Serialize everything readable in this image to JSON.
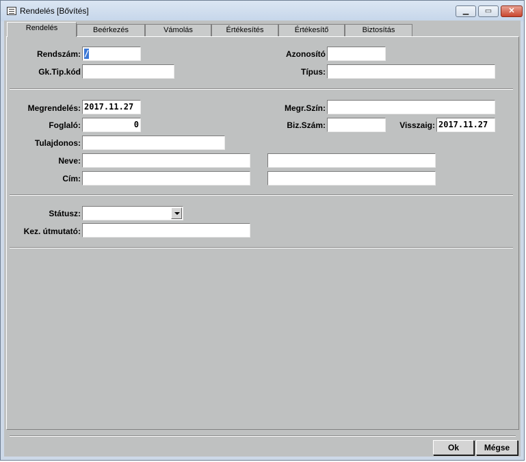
{
  "window": {
    "title": "Rendelés [Bővítés]"
  },
  "tabs": [
    {
      "label": "Rendelés"
    },
    {
      "label": "Beérkezés"
    },
    {
      "label": "Vámolás"
    },
    {
      "label": "Értékesítés"
    },
    {
      "label": "Értékesítő"
    },
    {
      "label": "Biztosítás"
    }
  ],
  "form": {
    "rendszam": {
      "label": "Rendszám:",
      "value": "/"
    },
    "azonosito": {
      "label": "Azonosító",
      "value": ""
    },
    "gktipkod": {
      "label": "Gk.Tip.kód",
      "value": ""
    },
    "tipus": {
      "label": "Típus:",
      "value": ""
    },
    "megrendeles": {
      "label": "Megrendelés:",
      "value": "2017.11.27"
    },
    "megr_szin": {
      "label": "Megr.Szín:",
      "value": ""
    },
    "foglalo": {
      "label": "Foglaló:",
      "value": "0"
    },
    "biz_szam": {
      "label": "Biz.Szám:",
      "value": ""
    },
    "visszaig": {
      "label": "Visszaig:",
      "value": "2017.11.27"
    },
    "tulajdonos": {
      "label": "Tulajdonos:",
      "value": ""
    },
    "neve": {
      "label": "Neve:",
      "value1": "",
      "value2": ""
    },
    "cim": {
      "label": "Cím:",
      "value1": "",
      "value2": ""
    },
    "statusz": {
      "label": "Státusz:",
      "value": ""
    },
    "kez_utmutato": {
      "label": "Kez. útmutató:",
      "value": ""
    }
  },
  "buttons": {
    "ok": "Ok",
    "cancel": "Mégse"
  }
}
